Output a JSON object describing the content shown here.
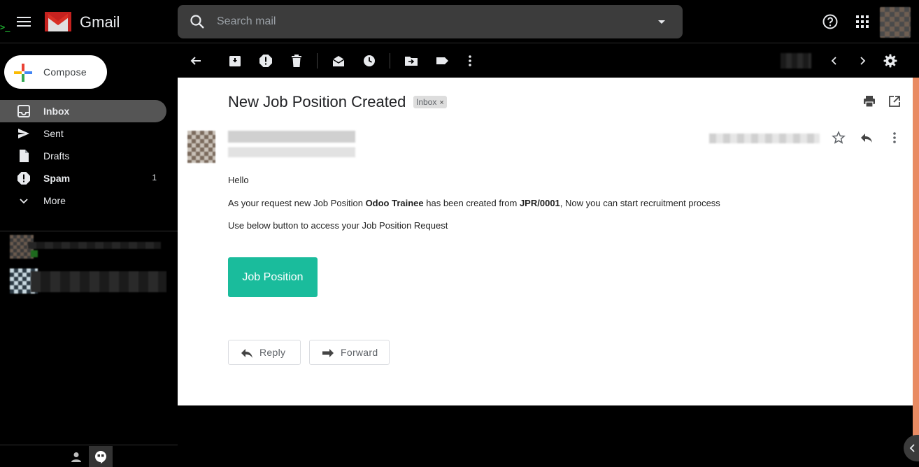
{
  "header": {
    "app_name": "Gmail",
    "terminal_glyph": ">_",
    "search_placeholder": "Search mail"
  },
  "compose": {
    "label": "Compose"
  },
  "sidebar": {
    "items": [
      {
        "label": "Inbox",
        "icon": "inbox-icon",
        "active": true,
        "bold": true,
        "count": ""
      },
      {
        "label": "Sent",
        "icon": "send-icon",
        "active": false,
        "bold": false,
        "count": ""
      },
      {
        "label": "Drafts",
        "icon": "draft-icon",
        "active": false,
        "bold": false,
        "count": ""
      },
      {
        "label": "Spam",
        "icon": "spam-icon",
        "active": false,
        "bold": true,
        "count": "1"
      },
      {
        "label": "More",
        "icon": "chevron-down-icon",
        "active": false,
        "bold": false,
        "count": ""
      }
    ]
  },
  "message": {
    "subject": "New Job Position Created",
    "label_chip": "Inbox",
    "label_chip_close": "×",
    "greeting": "Hello",
    "line1_prefix": "As your request new Job Position ",
    "line1_position": "Odoo Trainee",
    "line1_middle": " has been created from ",
    "line1_ref": "JPR/0001",
    "line1_suffix": ", Now you can start recruitment process",
    "line2": "Use below button to access your Job Position Request",
    "cta_button": "Job Position",
    "reply_label": "Reply",
    "forward_label": "Forward"
  },
  "colors": {
    "cta": "#1abc9c",
    "accent_bar": "#e98b63",
    "active_nav": "#555555",
    "background": "#000000"
  }
}
